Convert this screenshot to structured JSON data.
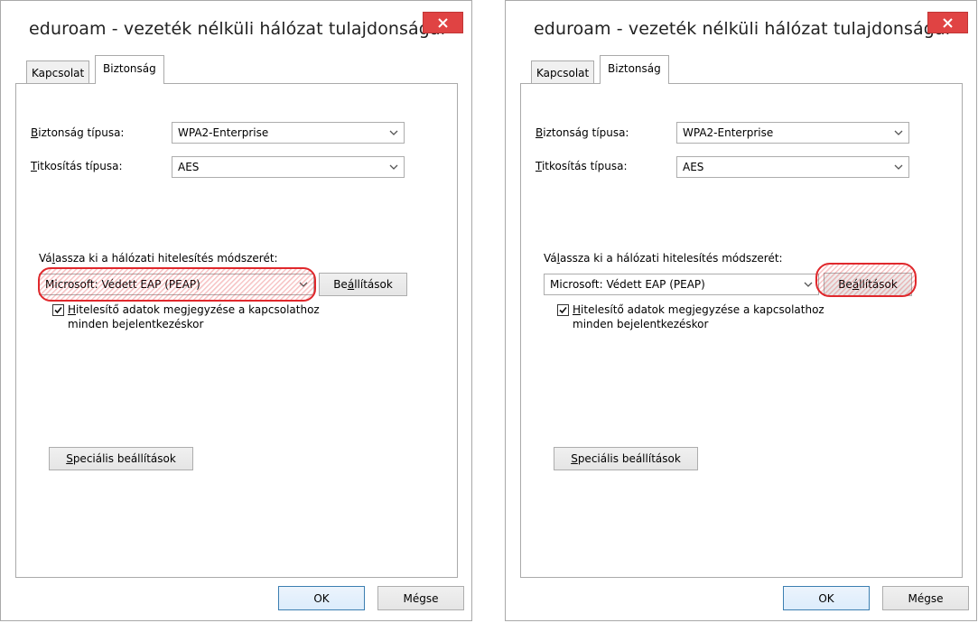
{
  "dialogs": [
    {
      "title": "eduroam - vezeték nélküli hálózat tulajdonságai",
      "tabs": [
        {
          "label": "Kapcsolat",
          "selected": false
        },
        {
          "label": "Biztonság",
          "selected": true
        }
      ],
      "security_type": {
        "label_prefix": "B",
        "label_rest": "iztonság típusa:",
        "value": "WPA2-Enterprise"
      },
      "encryption_type": {
        "label_prefix": "T",
        "label_rest": "itkosítás típusa:",
        "value": "AES"
      },
      "auth_method": {
        "label_a": "Vá",
        "label_u": "l",
        "label_b": "assza ki a hálózati hitelesítés módszerét:",
        "value": "Microsoft: Védett EAP (PEAP)"
      },
      "settings_button": {
        "label_a": "Be",
        "label_u": "á",
        "label_b": "llítások"
      },
      "remember_checkbox": {
        "checked": true,
        "label_u": "H",
        "label_line1": "itelesítő adatok megjegyzése a kapcsolathoz",
        "label_line2": "minden bejelentkezéskor"
      },
      "advanced_button": {
        "label_u": "S",
        "label_rest": "peciális beállítások"
      },
      "ok_button": "OK",
      "cancel_button": "Mégse",
      "highlighted": "auth-method-combo"
    },
    {
      "title": "eduroam - vezeték nélküli hálózat tulajdonságai",
      "tabs": [
        {
          "label": "Kapcsolat",
          "selected": false
        },
        {
          "label": "Biztonság",
          "selected": true
        }
      ],
      "security_type": {
        "label_prefix": "B",
        "label_rest": "iztonság típusa:",
        "value": "WPA2-Enterprise"
      },
      "encryption_type": {
        "label_prefix": "T",
        "label_rest": "itkosítás típusa:",
        "value": "AES"
      },
      "auth_method": {
        "label_a": "Vá",
        "label_u": "l",
        "label_b": "assza ki a hálózati hitelesítés módszerét:",
        "value": "Microsoft: Védett EAP (PEAP)"
      },
      "settings_button": {
        "label_a": "Be",
        "label_u": "á",
        "label_b": "llítások"
      },
      "remember_checkbox": {
        "checked": true,
        "label_u": "H",
        "label_line1": "itelesítő adatok megjegyzése a kapcsolathoz",
        "label_line2": "minden bejelentkezéskor"
      },
      "advanced_button": {
        "label_u": "S",
        "label_rest": "peciális beállítások"
      },
      "ok_button": "OK",
      "cancel_button": "Mégse",
      "highlighted": "settings-button"
    }
  ],
  "icons": {
    "close": "close-icon",
    "dropdown": "chevron-down-icon",
    "check": "checkmark-icon"
  },
  "colors": {
    "close_button": "#e04343",
    "highlight": "#e0282c",
    "ok_border": "#3c7fb1"
  }
}
